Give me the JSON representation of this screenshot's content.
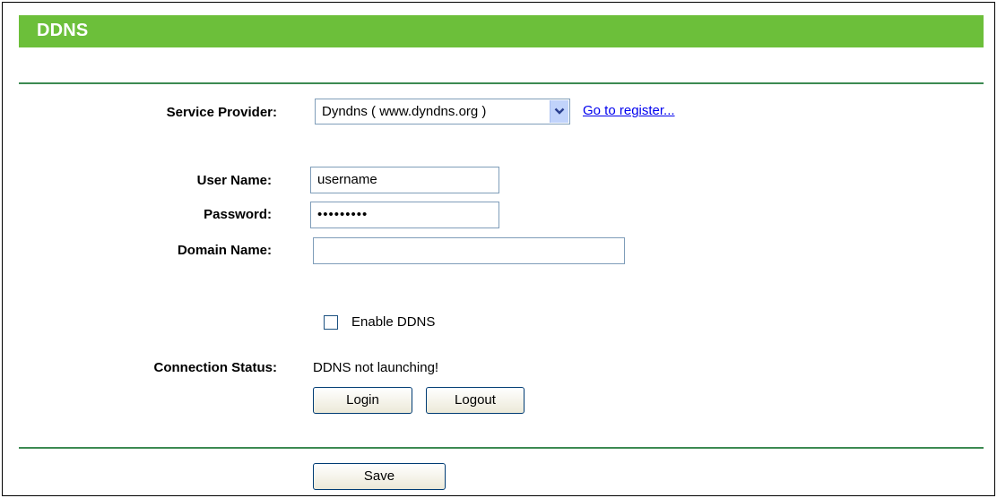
{
  "header": {
    "title": "DDNS"
  },
  "form": {
    "service_provider": {
      "label": "Service Provider:",
      "selected": "Dyndns ( www.dyndns.org )",
      "register_link": "Go to register..."
    },
    "user_name": {
      "label": "User Name:",
      "value": "username"
    },
    "password": {
      "label": "Password:",
      "value": "•••••••••"
    },
    "domain_name": {
      "label": "Domain Name:",
      "value": ""
    },
    "enable_ddns": {
      "label": "Enable DDNS",
      "checked": false
    },
    "connection_status": {
      "label": "Connection Status:",
      "value": "DDNS not launching!"
    },
    "buttons": {
      "login": "Login",
      "logout": "Logout",
      "save": "Save"
    }
  },
  "colors": {
    "title_bar": "#6cbf3a",
    "divider": "#3c8a52",
    "link": "#0000ee",
    "input_border": "#7f9db9"
  },
  "icons": {
    "dropdown": "chevron-down-icon"
  }
}
